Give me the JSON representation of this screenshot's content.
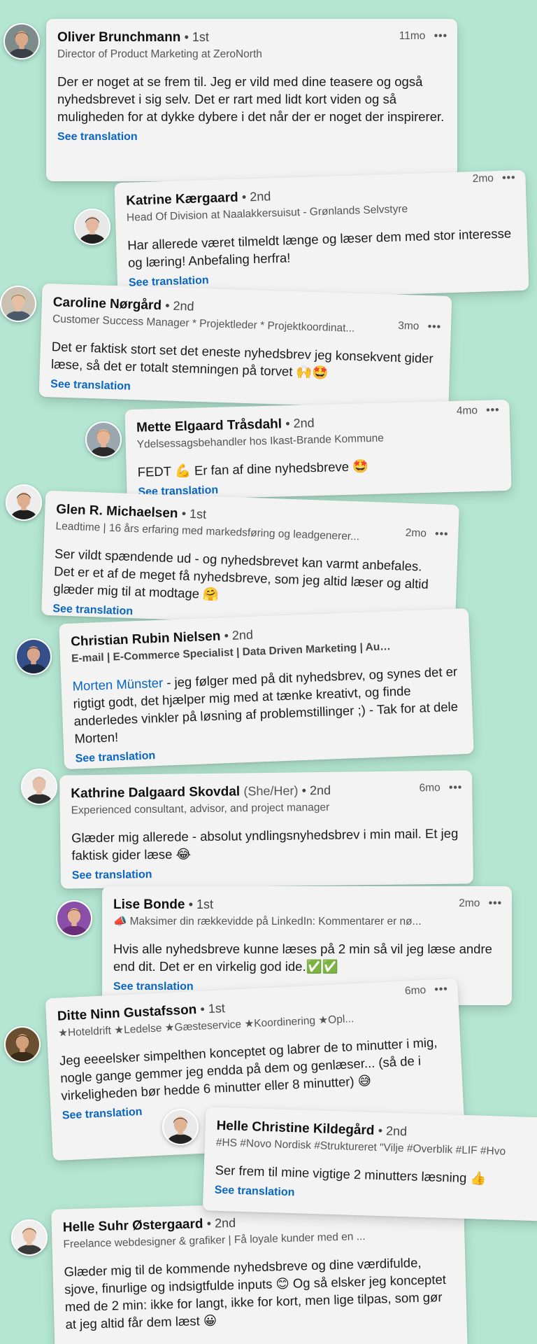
{
  "comments": [
    {
      "name": "Oliver Brunchmann",
      "degree": "• 1st",
      "headline": "Director of Product Marketing at ZeroNorth",
      "time": "11mo",
      "text": "Der er noget at se frem til. Jeg er vild med dine teasere og også nyhedsbrevet i sig selv. Det er rart med lidt kort viden og så muligheden for at dykke dybere i det når der er noget der inspirerer.",
      "see_translation": "See translation",
      "avatar_colors": {
        "bg": "#7d8c8a",
        "skin": "#d9a98a",
        "hair": "#6b5440",
        "shirt": "#3b3f47"
      }
    },
    {
      "name": "Katrine Kærgaard",
      "degree": "• 2nd",
      "headline": "Head Of Division at Naalakkersuisut - Grønlands Selvstyre",
      "time": "2mo",
      "text": "Har allerede været tilmeldt længe og læser dem med stor interesse og læring! Anbefaling herfra!",
      "see_translation": "See translation",
      "avatar_colors": {
        "bg": "#e8e8e8",
        "skin": "#e2b9a0",
        "hair": "#1c1c1c",
        "shirt": "#202020"
      }
    },
    {
      "name": "Caroline Nørgård",
      "degree": "• 2nd",
      "headline": "Customer Success Manager * Projektleder * Projektkoordinat...",
      "time": "3mo",
      "text": "Det er faktisk stort set det eneste nyhedsbrev jeg konsekvent gider læse, så det er totalt stemningen på torvet 🙌🤩",
      "see_translation": "See translation",
      "avatar_colors": {
        "bg": "#c9c2b3",
        "skin": "#e7bfa2",
        "hair": "#8a6a3c",
        "shirt": "#4a5a6a"
      }
    },
    {
      "name": "Mette Elgaard Tråsdahl",
      "degree": "• 2nd",
      "headline": "Ydelsessagsbehandler hos Ikast-Brande Kommune",
      "time": "4mo",
      "text": "FEDT 💪 Er fan af dine nyhedsbreve 🤩",
      "see_translation": "See translation",
      "avatar_colors": {
        "bg": "#9aa7ae",
        "skin": "#e6b597",
        "hair": "#d08a3e",
        "shirt": "#2a2a2a"
      }
    },
    {
      "name": "Glen R. Michaelsen",
      "degree": "• 1st",
      "headline": "Leadtime | 16 års erfaring med markedsføring og leadgenerer...",
      "time": "2mo",
      "text": "Ser vildt spændende ud - og nyhedsbrevet kan varmt anbefales. Det er et af de meget få nyhedsbreve, som jeg altid læser og altid glæder mig til at modtage 🤗",
      "see_translation": "See translation",
      "avatar_colors": {
        "bg": "#ededed",
        "skin": "#e0ad8e",
        "hair": "#2d2419",
        "shirt": "#1e1e1e"
      }
    },
    {
      "name": "Christian Rubin Nielsen",
      "degree": "• 2nd",
      "headline": "E-mail | E-Commerce Specialist | Data Driven Marketing | Automa...",
      "time": "",
      "mention": "Morten Münster",
      "text": " - jeg følger med på dit nyhedsbrev, og synes det er rigtigt godt, det hjælper mig med at tænke kreativt, og finde anderledes vinkler på løsning af problemstillinger ;) - Tak for at dele Morten!",
      "see_translation": "See translation",
      "avatar_colors": {
        "bg": "#34508a",
        "skin": "#d8a58a",
        "hair": "#2b2118",
        "shirt": "#1a2740"
      }
    },
    {
      "name": "Kathrine Dalgaard Skovdal",
      "pronouns": "(She/Her)",
      "degree": "• 2nd",
      "headline": "Experienced consultant, advisor, and project manager",
      "time": "6mo",
      "text": "Glæder mig allerede - absolut yndlingsnyhedsbrev i min mail. Et jeg faktisk gider læse 😂",
      "see_translation": "See translation",
      "avatar_colors": {
        "bg": "#f0f0f0",
        "skin": "#e6bfa8",
        "hair": "#b8b2a6",
        "shirt": "#2b2b2b"
      }
    },
    {
      "name": "Lise Bonde",
      "degree": "• 1st",
      "headline": "📣 Maksimer din rækkevidde på LinkedIn: Kommentarer er nø...",
      "time": "2mo",
      "text": "Hvis alle nyhedsbreve kunne læses på 2 min så vil jeg læse andre end dit. Det er en virkelig god ide.✅✅",
      "see_translation": "See translation",
      "avatar_colors": {
        "bg": "#8a4fa8",
        "skin": "#e4b096",
        "hair": "#5a3320",
        "shirt": "#6a2d7a"
      }
    },
    {
      "name": "Ditte Ninn Gustafsson",
      "degree": "• 1st",
      "headline": "★Hoteldrift ★Ledelse ★Gæsteservice ★Koordinering ★Opl...",
      "time": "6mo",
      "text": "Jeg eeeelsker simpelthen konceptet og labrer de to minutter i mig, nogle gange gemmer jeg endda på dem og genlæser... (så de i virkeligheden bør hedde 6 minutter eller 8 minutter) 😅",
      "see_translation": "See translation",
      "avatar_colors": {
        "bg": "#6a5030",
        "skin": "#d3a07c",
        "hair": "#2a1c10",
        "shirt": "#3a2a1a"
      }
    },
    {
      "name": "Helle Christine Kildegård",
      "degree": "• 2nd",
      "headline": "#HS #Novo Nordisk #Struktureret \"Vilje #Overblik #LIF #Hvo",
      "time": "",
      "text": "Ser frem til mine vigtige 2 minutters læsning 👍",
      "see_translation": "See translation",
      "avatar_colors": {
        "bg": "#e9e9e9",
        "skin": "#e0b393",
        "hair": "#2c1f17",
        "shirt": "#222222"
      }
    },
    {
      "name": "Helle Suhr Østergaard",
      "degree": "• 2nd",
      "headline": "Freelance webdesigner & grafiker | Få loyale kunder med en ...",
      "time": "",
      "text": "Glæder mig til de kommende nyhedsbreve og dine værdifulde, sjove, finurlige og indsigtfulde inputs 😊 Og så elsker jeg konceptet med de 2 min: ikke for langt, ikke for kort, men lige tilpas, som gør at jeg altid får dem læst 😀",
      "see_translation": "",
      "avatar_colors": {
        "bg": "#efefef",
        "skin": "#e9c2a8",
        "hair": "#5b3e2a",
        "shirt": "#3a3a3a"
      }
    }
  ]
}
